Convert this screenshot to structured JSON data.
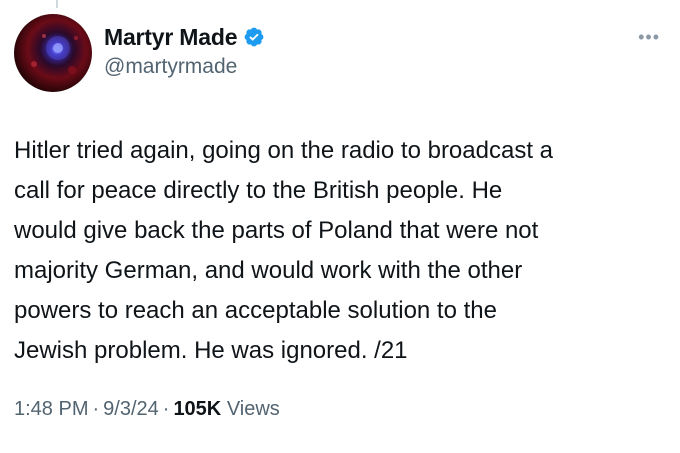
{
  "author": {
    "display_name": "Martyr Made",
    "handle": "@martyrmade",
    "verified": true,
    "verified_color": "#1d9bf0"
  },
  "more_menu_icon": "more-horizontal-icon",
  "tweet": {
    "lines": [
      "Hitler tried again, going on the radio to broadcast a",
      "call for peace directly to the British people. He",
      "would give back the parts of Poland that were not",
      "majority German, and would work with the other",
      "powers to reach an acceptable solution to the",
      "Jewish problem. He was ignored. /21"
    ]
  },
  "meta": {
    "time": "1:48 PM",
    "date": "9/3/24",
    "separator": "·",
    "views_count": "105K",
    "views_label": "Views"
  },
  "colors": {
    "text_primary": "#0f1419",
    "text_secondary": "#536471"
  }
}
